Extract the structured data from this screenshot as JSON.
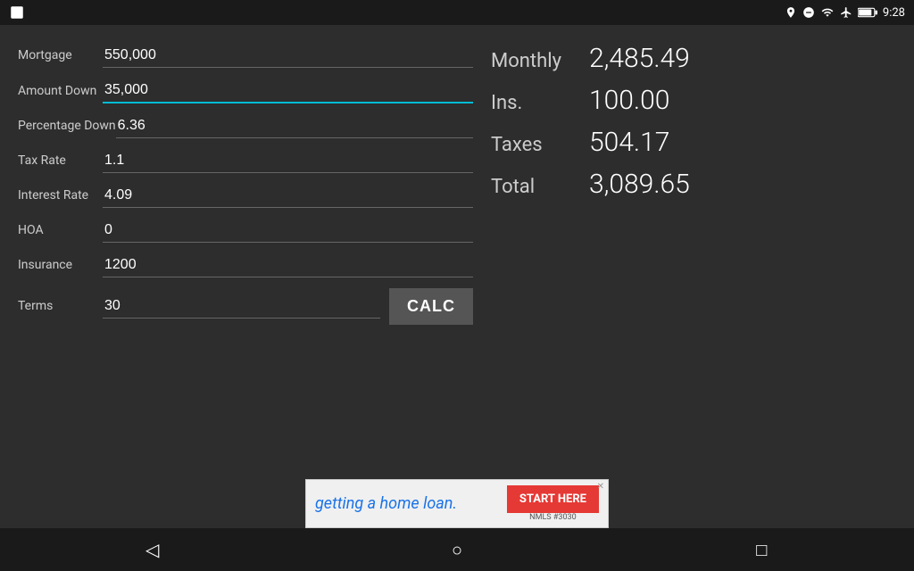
{
  "statusBar": {
    "time": "9:28",
    "icons": [
      "location",
      "minus-circle",
      "wifi",
      "airplane",
      "battery"
    ]
  },
  "form": {
    "mortgage": {
      "label": "Mortgage",
      "value": "550,000"
    },
    "amountDown": {
      "label": "Amount Down",
      "value": "35,000",
      "active": true
    },
    "percentageDown": {
      "label": "Percentage Down",
      "value": "6.36"
    },
    "taxRate": {
      "label": "Tax Rate",
      "value": "1.1"
    },
    "interestRate": {
      "label": "Interest Rate",
      "value": "4.09"
    },
    "hoa": {
      "label": "HOA",
      "value": "0"
    },
    "insurance": {
      "label": "Insurance",
      "value": "1200"
    },
    "terms": {
      "label": "Terms",
      "value": "30"
    },
    "calcButton": "CALC"
  },
  "results": {
    "monthly": {
      "label": "Monthly",
      "value": "2,485.49"
    },
    "insurance": {
      "label": "Ins.",
      "value": "100.00"
    },
    "taxes": {
      "label": "Taxes",
      "value": "504.17"
    },
    "total": {
      "label": "Total",
      "value": "3,089.65"
    }
  },
  "ad": {
    "text": "getting a home loan.",
    "ctaLine1": "START HERE",
    "ctaLine2": "NMLS #3030"
  },
  "nav": {
    "back": "◁",
    "home": "○",
    "recent": "□"
  }
}
